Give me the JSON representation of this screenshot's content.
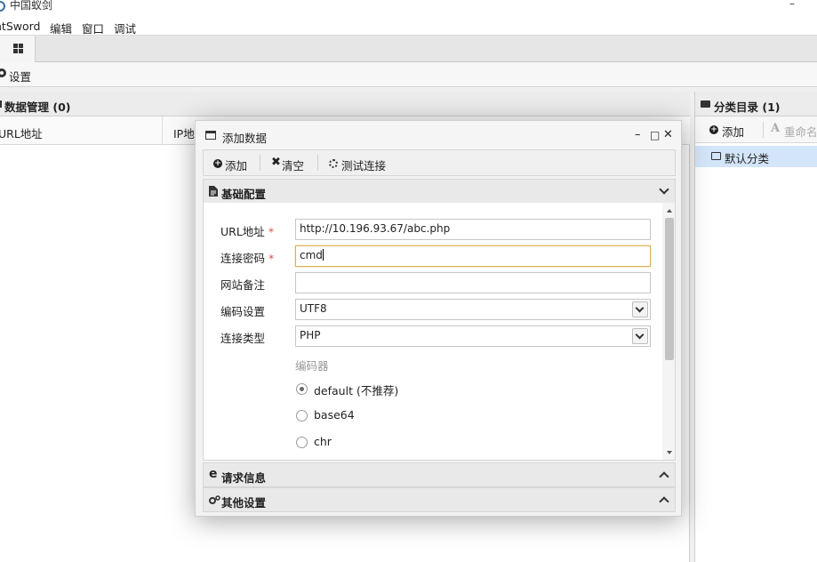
{
  "window": {
    "title": "中国蚁剑",
    "minimize_glyph": "–"
  },
  "menu": [
    "ntSword",
    "编辑",
    "窗口",
    "调试"
  ],
  "toolbar": {
    "settings_label": "设置"
  },
  "data_panel": {
    "title": "数据管理 (0)",
    "columns": [
      "URL地址",
      "IP地"
    ]
  },
  "category_panel": {
    "title": "分类目录 (1)",
    "add_label": "添加",
    "rename_label": "重命名",
    "rename_icon_glyph": "A",
    "categories": [
      "默认分类"
    ]
  },
  "modal": {
    "title": "添加数据",
    "controls": {
      "minimize": "–",
      "maximize": "□",
      "close": "✕"
    },
    "toolbar": {
      "add": "添加",
      "clear_icon": "✖",
      "clear": "清空",
      "test": "测试连接"
    },
    "sections": {
      "basic": "基础配置",
      "request": "请求信息",
      "other": "其他设置"
    },
    "fields": {
      "url": {
        "label": "URL地址",
        "required_mark": "*",
        "value": "http://10.196.93.67/abc.php"
      },
      "password": {
        "label": "连接密码",
        "required_mark": "*",
        "value": "cmd"
      },
      "note": {
        "label": "网站备注",
        "value": ""
      },
      "encoding": {
        "label": "编码设置",
        "value": "UTF8"
      },
      "type": {
        "label": "连接类型",
        "value": "PHP"
      }
    },
    "encoder": {
      "label": "编码器",
      "options": [
        "default (不推荐)",
        "base64",
        "chr"
      ],
      "selected_index": 0
    }
  },
  "colors": {
    "selected_category": "#d3e5f8",
    "required": "#d9534f",
    "focus_border": "#d8b35b"
  }
}
